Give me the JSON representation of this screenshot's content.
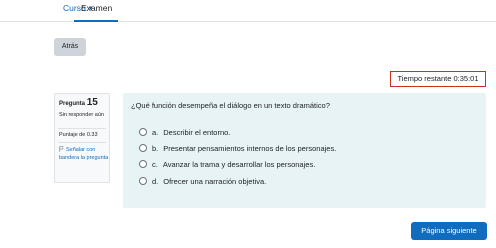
{
  "nav": {
    "curso_label": "Curso",
    "examen_label": "Examen"
  },
  "back_button": "Atrás",
  "timer": {
    "text": "Tiempo restante 0:35:01"
  },
  "question_info": {
    "prefix": "Pregunta",
    "number": "15",
    "state": "Sin responder aún",
    "grade": "Puntaje de 0.33",
    "flag_label": "Señalar con bandera la pregunta"
  },
  "question": {
    "text": "¿Qué función desempeña el diálogo en un texto dramático?",
    "options": [
      {
        "letter": "a.",
        "text": "Describir el entorno."
      },
      {
        "letter": "b.",
        "text": "Presentar pensamientos internos de los personajes."
      },
      {
        "letter": "c.",
        "text": "Avanzar la trama y desarrollar los personajes."
      },
      {
        "letter": "d.",
        "text": "Ofrecer una narración objetiva."
      }
    ]
  },
  "next_button": "Página siguiente",
  "colors": {
    "accent": "#0f6cbf",
    "timer_border": "#ca3120",
    "question_bg": "#e7f3f5"
  },
  "icons": {
    "curso_dropdown": "chevron-down-icon",
    "flag": "flag-icon"
  }
}
